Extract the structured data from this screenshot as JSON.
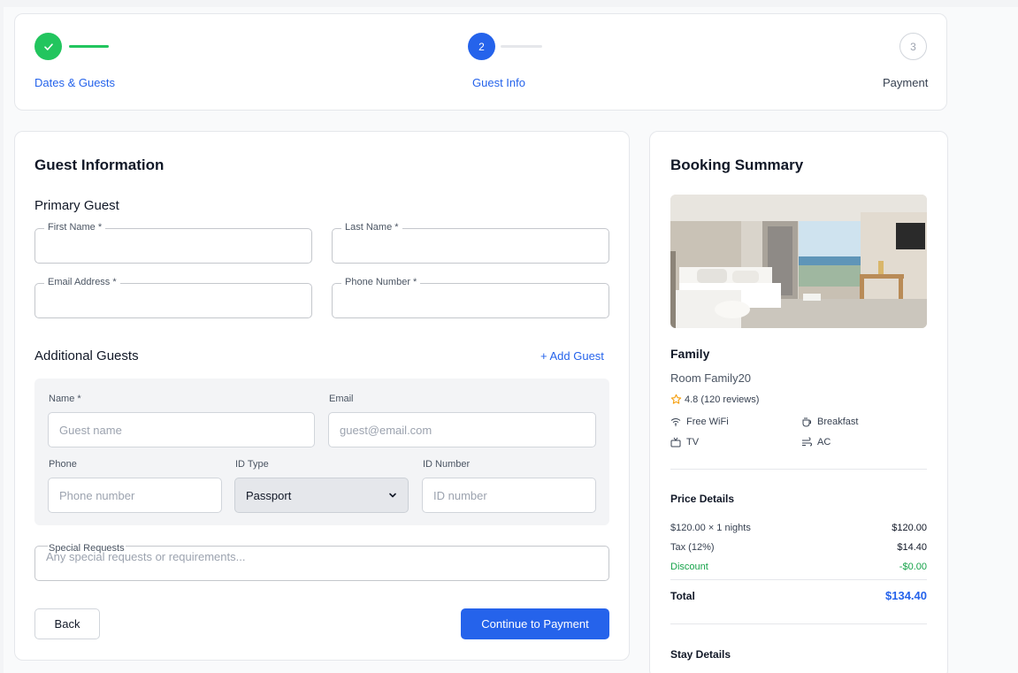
{
  "stepper": {
    "steps": [
      {
        "label": "Dates & Guests",
        "marker": "",
        "state": "done"
      },
      {
        "label": "Guest Info",
        "marker": "2",
        "state": "active"
      },
      {
        "label": "Payment",
        "marker": "3",
        "state": "todo"
      }
    ]
  },
  "form": {
    "title": "Guest Information",
    "primary_title": "Primary Guest",
    "first_name_label": "First Name *",
    "last_name_label": "Last Name *",
    "email_label": "Email Address *",
    "phone_label": "Phone Number *",
    "additional_title": "Additional Guests",
    "add_guest": "+ Add Guest",
    "guest": {
      "name_label": "Name *",
      "name_placeholder": "Guest name",
      "email_label": "Email",
      "email_placeholder": "guest@email.com",
      "phone_label": "Phone",
      "phone_placeholder": "Phone number",
      "id_type_label": "ID Type",
      "id_type_value": "Passport",
      "id_number_label": "ID Number",
      "id_number_placeholder": "ID number"
    },
    "special_label": "Special Requests",
    "special_placeholder": "Any special requests or requirements...",
    "back": "Back",
    "continue": "Continue to Payment"
  },
  "summary": {
    "title": "Booking Summary",
    "room_type": "Family",
    "room_name": "Room Family20",
    "rating": "4.8 (120 reviews)",
    "amenities": [
      "Free WiFi",
      "Breakfast",
      "TV",
      "AC"
    ],
    "price_title": "Price Details",
    "rows": [
      {
        "label": "$120.00 × 1 nights",
        "value": "$120.00"
      },
      {
        "label": "Tax (12%)",
        "value": "$14.40"
      },
      {
        "label": "Discount",
        "value": "-$0.00"
      }
    ],
    "total_label": "Total",
    "total_value": "$134.40",
    "stay_title": "Stay Details"
  },
  "colors": {
    "accent": "#2563eb",
    "success": "#22c55e",
    "discount": "#16a34a",
    "star": "#f59e0b"
  }
}
